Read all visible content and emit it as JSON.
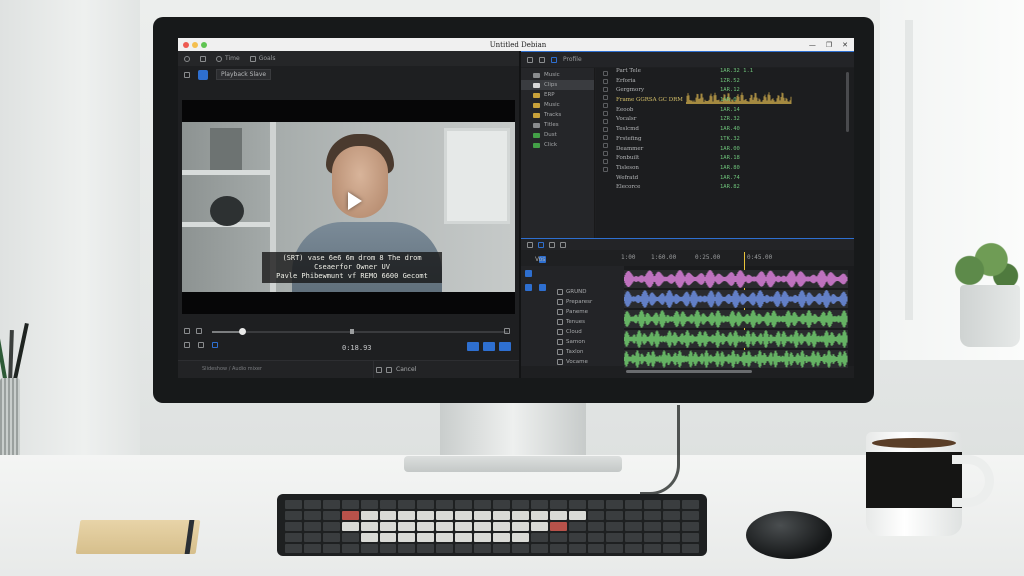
{
  "window": {
    "title": "Untitled Debian"
  },
  "menubar": {
    "items": [
      "Time",
      "Goals"
    ]
  },
  "viewer": {
    "toolbar_label": "Playback Slave",
    "subtitle_lines": [
      "(SRT) vase 6e6 6m drom 8 The drom",
      "Cseaerfor Owner UV",
      "Pavle Phibewmunt vf REMO 6600 Gecomt"
    ],
    "timecode": "0:18.93",
    "progress": 0.1,
    "status_left": "Slideshow / Audio mixer",
    "status_right_label": "Cancel"
  },
  "browser": {
    "toolbar_label": "Profile",
    "tree": [
      {
        "label": "Music",
        "color": "#8a8c8e"
      },
      {
        "label": "Clips",
        "color": "#d9d9d9"
      },
      {
        "label": "ERP",
        "color": "#c9a23a"
      },
      {
        "label": "Music",
        "color": "#c9a23a"
      },
      {
        "label": "Tracks",
        "color": "#c9a23a"
      },
      {
        "label": "Titles",
        "color": "#8a8c8e"
      },
      {
        "label": "Dust",
        "color": "#43a047"
      },
      {
        "label": "Click",
        "color": "#43a047"
      }
    ],
    "names": [
      {
        "text": "Part Tele",
        "hl": false
      },
      {
        "text": "Erforia",
        "hl": false
      },
      {
        "text": "Gergmory",
        "hl": false
      },
      {
        "text": "Frame GGRSA GC DRM",
        "hl": true
      },
      {
        "text": "Eeoob",
        "hl": false
      },
      {
        "text": "Vocalsr",
        "hl": false
      },
      {
        "text": "Teslcmd",
        "hl": false
      },
      {
        "text": "Frstefing",
        "hl": false
      },
      {
        "text": "Deammer",
        "hl": false
      },
      {
        "text": "Fonbuilt",
        "hl": false
      },
      {
        "text": "Tisleson",
        "hl": false
      },
      {
        "text": "Wefratd",
        "hl": false
      },
      {
        "text": "Elecorce",
        "hl": false
      }
    ],
    "values": [
      "1AR.32 1.1",
      "1ZR.52",
      "1AR.12",
      "1AR.0",
      "1AR.14",
      "1ZR.32",
      "1AR.40",
      "1TK.32",
      "1AR.00",
      "1AR.18",
      "1AR.80",
      "1AR.74",
      "1AR.82"
    ]
  },
  "timeline": {
    "ruler": [
      "1:00",
      "1:60.00",
      "0:25.00",
      "0:45.00"
    ],
    "track_head_label": "Vos",
    "tracks": [
      {
        "label": "GRUND",
        "color": "#d07ad0"
      },
      {
        "label": "Preparesr",
        "color": "#6a8ad8"
      },
      {
        "label": "Paneme",
        "color": "#6cc26a"
      },
      {
        "label": "Tenues",
        "color": "#6cc26a"
      },
      {
        "label": "Cloud",
        "color": "#6cc26a"
      },
      {
        "label": "Samon",
        "color": "#6cc26a"
      },
      {
        "label": "Taxlon",
        "color": "#6cc26a"
      },
      {
        "label": "Vocame",
        "color": "#6cc26a"
      }
    ]
  },
  "colors": {
    "accent": "#2e6fd0",
    "playhead": "#e8c33a",
    "waveform_yellow": "#c7a64a"
  }
}
